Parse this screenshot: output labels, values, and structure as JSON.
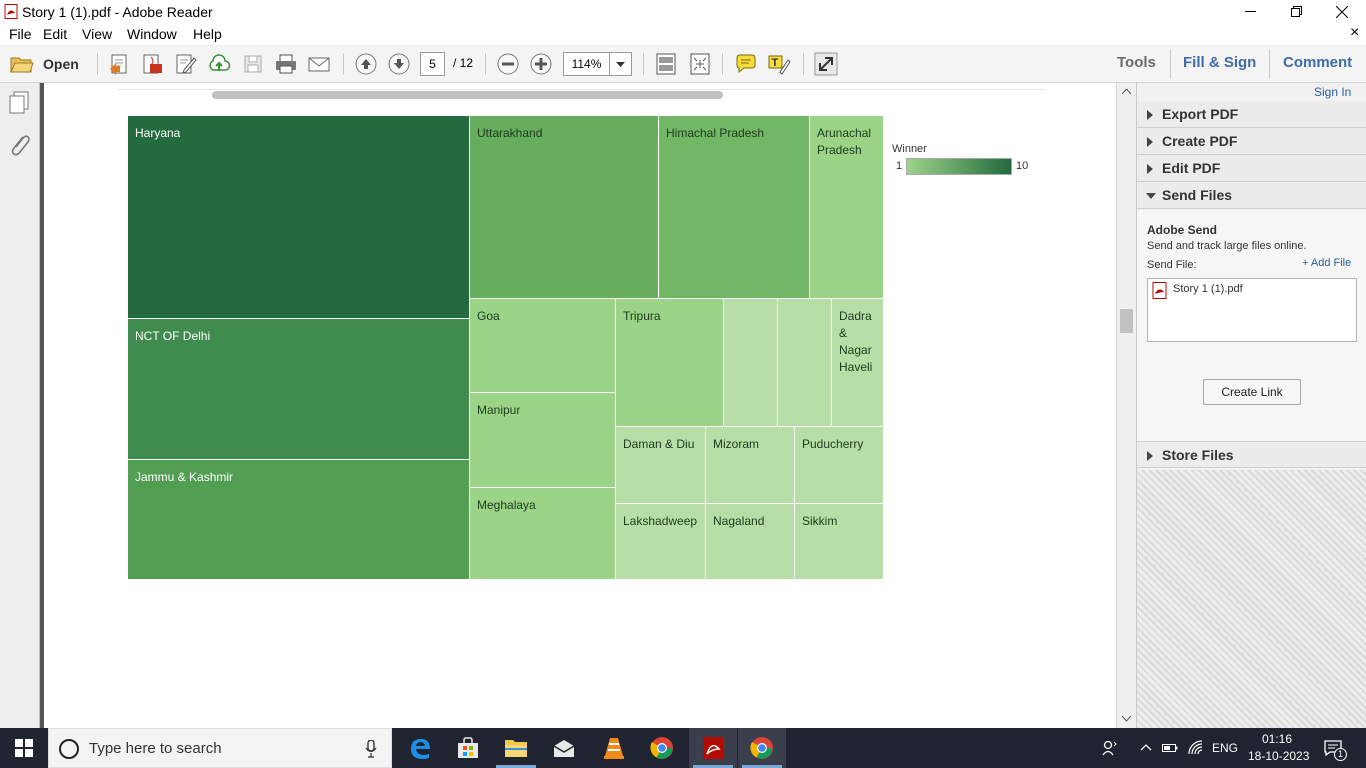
{
  "window": {
    "title": "Story 1 (1).pdf - Adobe Reader"
  },
  "menu": {
    "items": [
      "File",
      "Edit",
      "View",
      "Window",
      "Help"
    ],
    "close_doc": "×"
  },
  "toolbar": {
    "open_label": "Open",
    "page_current": "5",
    "page_total": "/ 12",
    "zoom": "114%",
    "tabs": {
      "tools": "Tools",
      "fill_sign": "Fill & Sign",
      "comment": "Comment"
    }
  },
  "right_panel": {
    "sign_in": "Sign In",
    "sections": {
      "export": "Export PDF",
      "create": "Create PDF",
      "edit": "Edit PDF",
      "send": "Send Files",
      "store": "Store Files"
    },
    "adobe_send": {
      "heading": "Adobe Send",
      "description": "Send and track large files online.",
      "send_file_label": "Send File:",
      "add_file": "+ Add File",
      "file_name": "Story 1 (1).pdf",
      "create_link": "Create Link"
    }
  },
  "chart_data": {
    "type": "treemap",
    "legend": {
      "title": "Winner",
      "min": "1",
      "max": "10",
      "color_low": "#9ed38a",
      "color_high": "#226a3e"
    },
    "cells": [
      {
        "name": "Haryana",
        "color": "#236a3f",
        "text_color": "#ffffff"
      },
      {
        "name": "NCT OF Delhi",
        "color": "#3f8c4e",
        "text_color": "#ffffff"
      },
      {
        "name": "Jammu & Kashmir",
        "color": "#529e52",
        "text_color": "#ffffff"
      },
      {
        "name": "Uttarakhand",
        "color": "#66ae5d",
        "text_color": "#1e3a1e"
      },
      {
        "name": "Himachal Pradesh",
        "color": "#71b765",
        "text_color": "#1e3a1e"
      },
      {
        "name": "Arunachal Pradesh",
        "color": "#9bd487",
        "text_color": "#1e3a1e"
      },
      {
        "name": "Goa",
        "color": "#9bd487",
        "text_color": "#1e3a1e"
      },
      {
        "name": "Manipur",
        "color": "#9bd487",
        "text_color": "#1e3a1e"
      },
      {
        "name": "Meghalaya",
        "color": "#9bd487",
        "text_color": "#1e3a1e"
      },
      {
        "name": "Tripura",
        "color": "#9bd487",
        "text_color": "#1e3a1e"
      },
      {
        "name": "",
        "color": "#b6dea6",
        "text_color": "#1e3a1e"
      },
      {
        "name": "",
        "color": "#b6dea6",
        "text_color": "#1e3a1e"
      },
      {
        "name": "Dadra & Nagar Haveli",
        "color": "#b6dea6",
        "text_color": "#1e3a1e"
      },
      {
        "name": "Daman & Diu",
        "color": "#b6dea6",
        "text_color": "#1e3a1e"
      },
      {
        "name": "Mizoram",
        "color": "#b6dea6",
        "text_color": "#1e3a1e"
      },
      {
        "name": "Puducherry",
        "color": "#b6dea6",
        "text_color": "#1e3a1e"
      },
      {
        "name": "Lakshadweep",
        "color": "#b6dea6",
        "text_color": "#1e3a1e"
      },
      {
        "name": "Nagaland",
        "color": "#b6dea6",
        "text_color": "#1e3a1e"
      },
      {
        "name": "Sikkim",
        "color": "#b6dea6",
        "text_color": "#1e3a1e"
      }
    ]
  },
  "taskbar": {
    "search_placeholder": "Type here to search",
    "language": "ENG",
    "time": "01:16",
    "date": "18-10-2023",
    "notification_count": "1"
  }
}
